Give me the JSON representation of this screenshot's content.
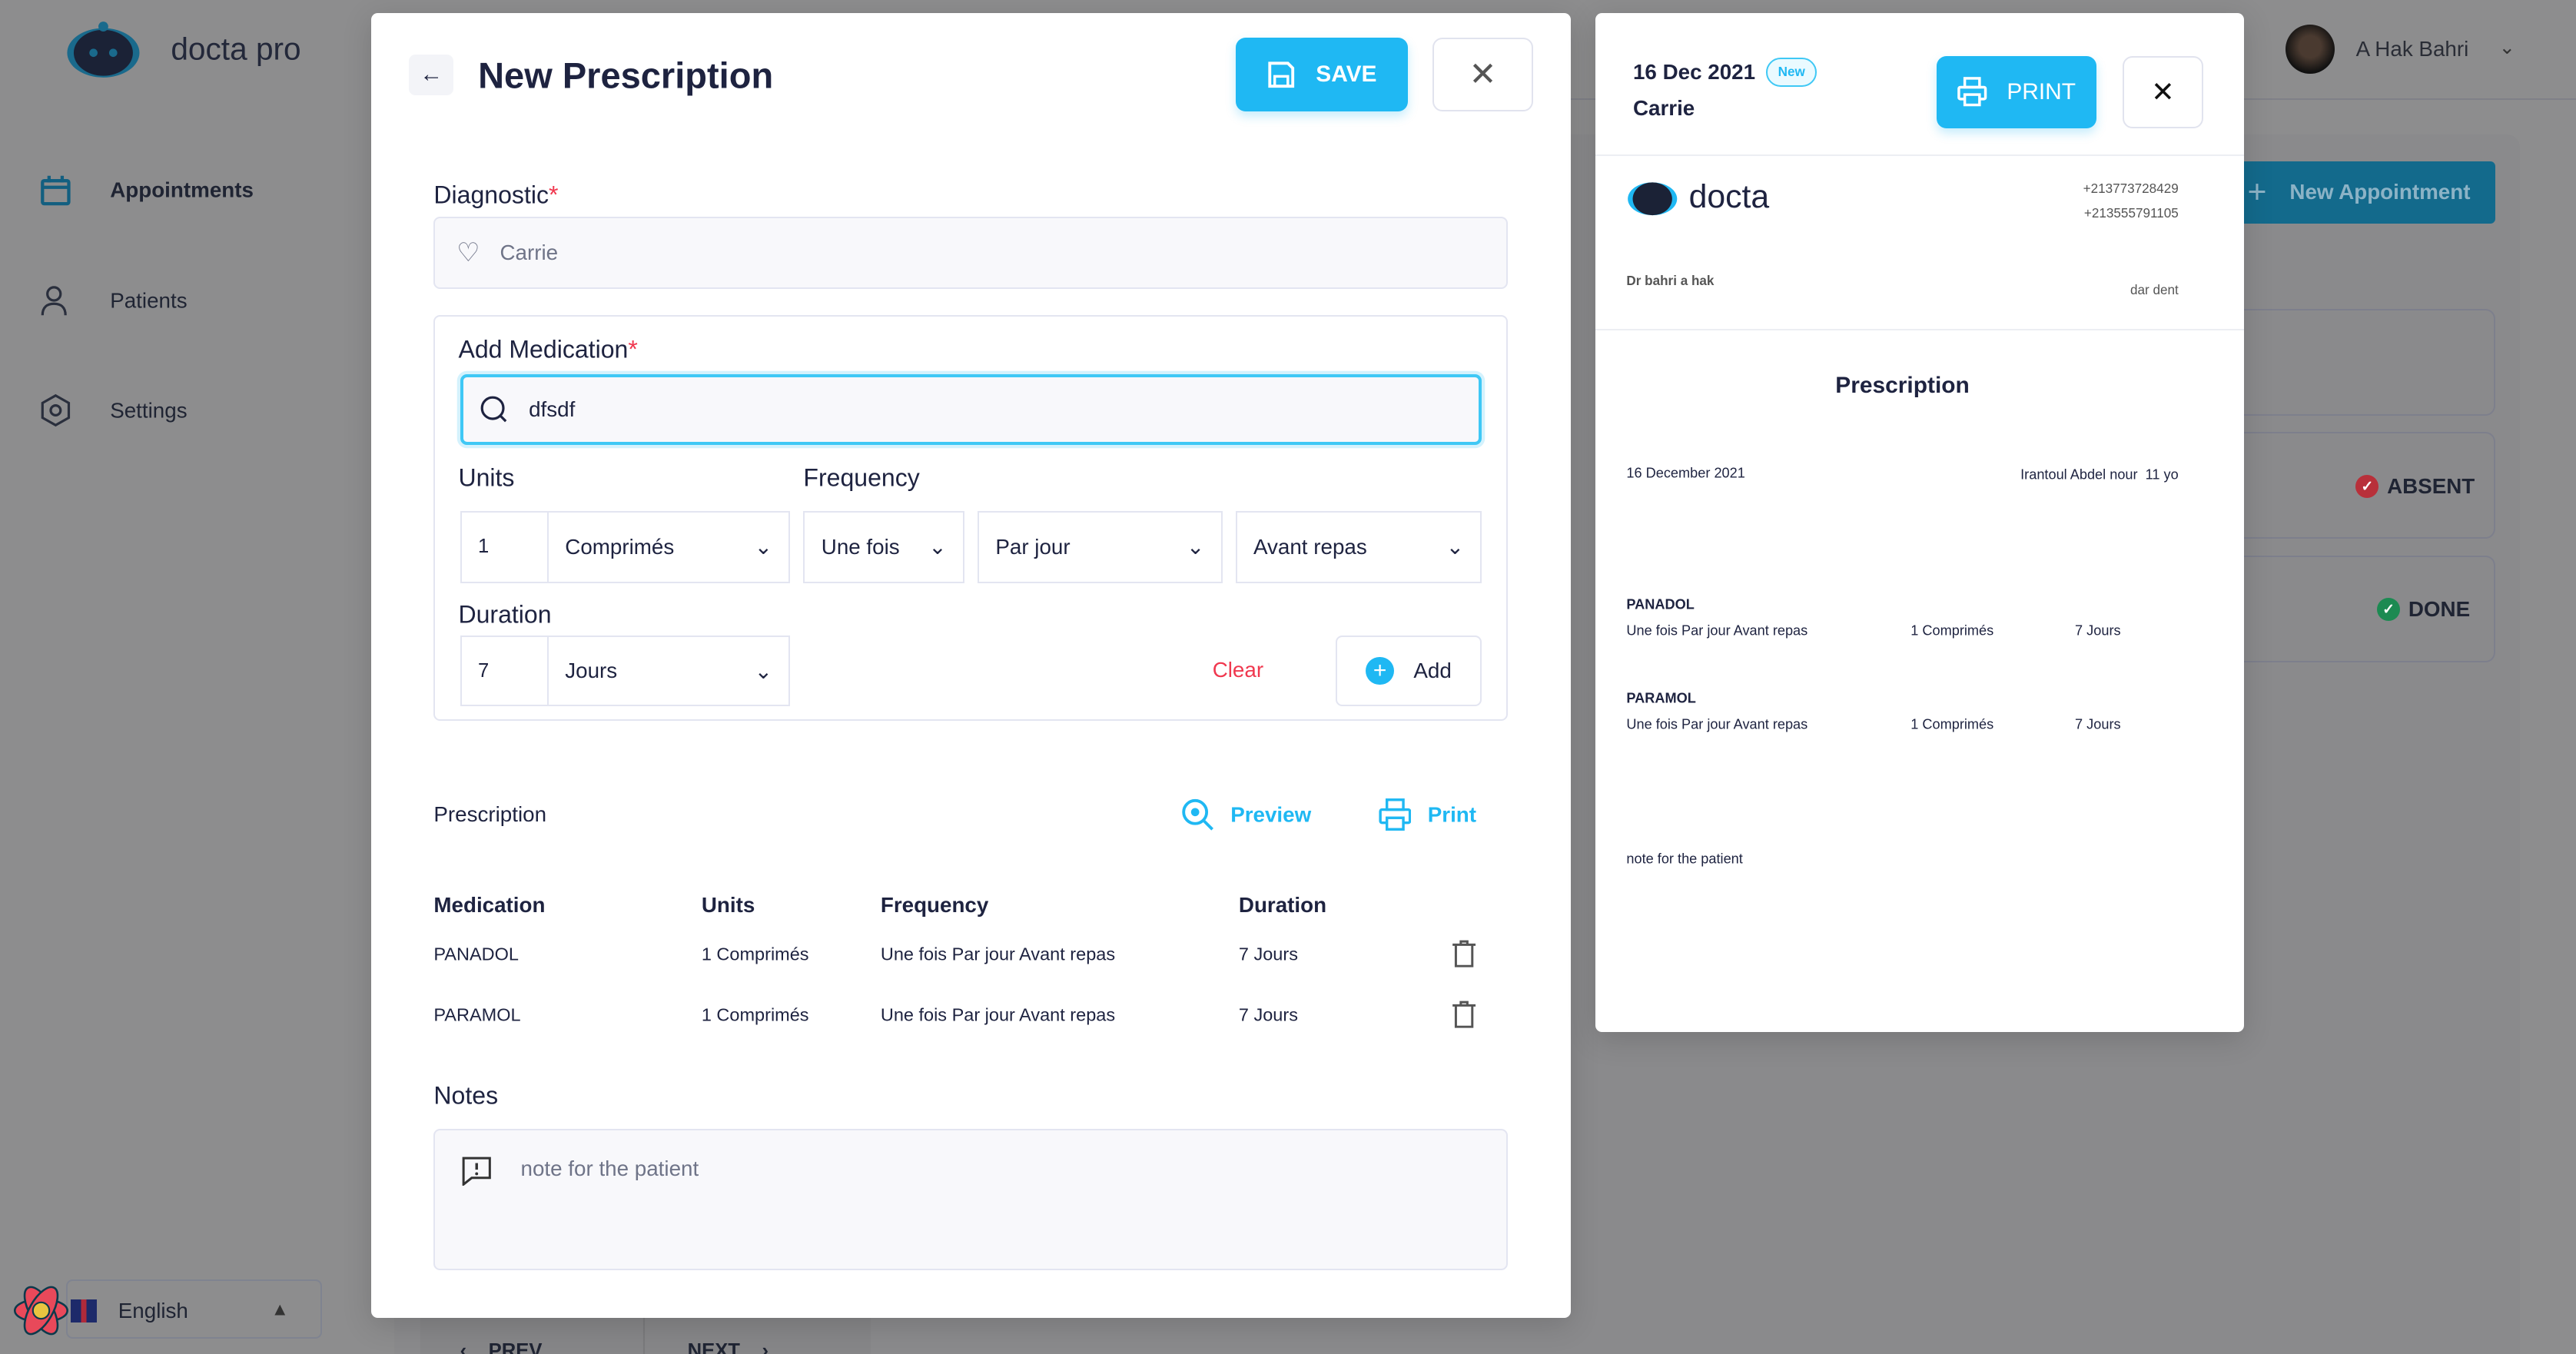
{
  "app": {
    "brand": "docta pro",
    "user_name": "A Hak Bahri"
  },
  "sidebar": {
    "items": [
      {
        "label": "Appointments",
        "icon": "calendar-icon"
      },
      {
        "label": "Patients",
        "icon": "users-icon"
      },
      {
        "label": "Settings",
        "icon": "settings-icon"
      }
    ],
    "language": "English"
  },
  "background": {
    "new_appointment": "New Appointment",
    "status_absent": "ABSENT",
    "status_done": "DONE",
    "prev": "PREV",
    "next": "NEXT"
  },
  "colors": {
    "accent": "#1fb8f3",
    "danger": "#f0384f",
    "success": "#22b06b",
    "absent": "#d6343f"
  },
  "prescription_form": {
    "title": "New Prescription",
    "save_label": "SAVE",
    "diagnostic_label": "Diagnostic",
    "diagnostic_value": "Carrie",
    "add_medication_label": "Add Medication",
    "medication_search": "dfsdf",
    "units_label": "Units",
    "units_value": "1",
    "units_type": "Comprimés",
    "frequency_label": "Frequency",
    "frequency_times": "Une fois",
    "frequency_period": "Par jour",
    "frequency_timing": "Avant repas",
    "duration_label": "Duration",
    "duration_value": "7",
    "duration_unit": "Jours",
    "clear_label": "Clear",
    "add_label": "Add",
    "prescription_label": "Prescription",
    "preview_label": "Preview",
    "print_label": "Print",
    "table": {
      "headers": [
        "Medication",
        "Units",
        "Frequency",
        "Duration"
      ],
      "rows": [
        [
          "PANADOL",
          "1 Comprimés",
          "Une fois Par jour Avant repas",
          "7 Jours"
        ],
        [
          "PARAMOL",
          "1 Comprimés",
          "Une fois Par jour Avant repas",
          "7 Jours"
        ]
      ]
    },
    "notes_label": "Notes",
    "notes_value": "note for the patient"
  },
  "preview": {
    "date": "16 Dec 2021",
    "badge": "New",
    "patient": "Carrie",
    "print_label": "PRINT",
    "logo_text": "docta",
    "phone1": "+213773728429",
    "phone2": "+213555791105",
    "doctor": "Dr bahri a hak",
    "clinic": "dar dent",
    "heading": "Prescription",
    "full_date": "16 December 2021",
    "patient_line": "Irantoul Abdel nour  11 yo",
    "items": [
      {
        "name": "PANADOL",
        "frequency": "Une fois Par jour Avant repas",
        "units": "1 Comprimés",
        "duration": "7 Jours"
      },
      {
        "name": "PARAMOL",
        "frequency": "Une fois Par jour Avant repas",
        "units": "1 Comprimés",
        "duration": "7 Jours"
      }
    ],
    "note": "note for the patient"
  }
}
